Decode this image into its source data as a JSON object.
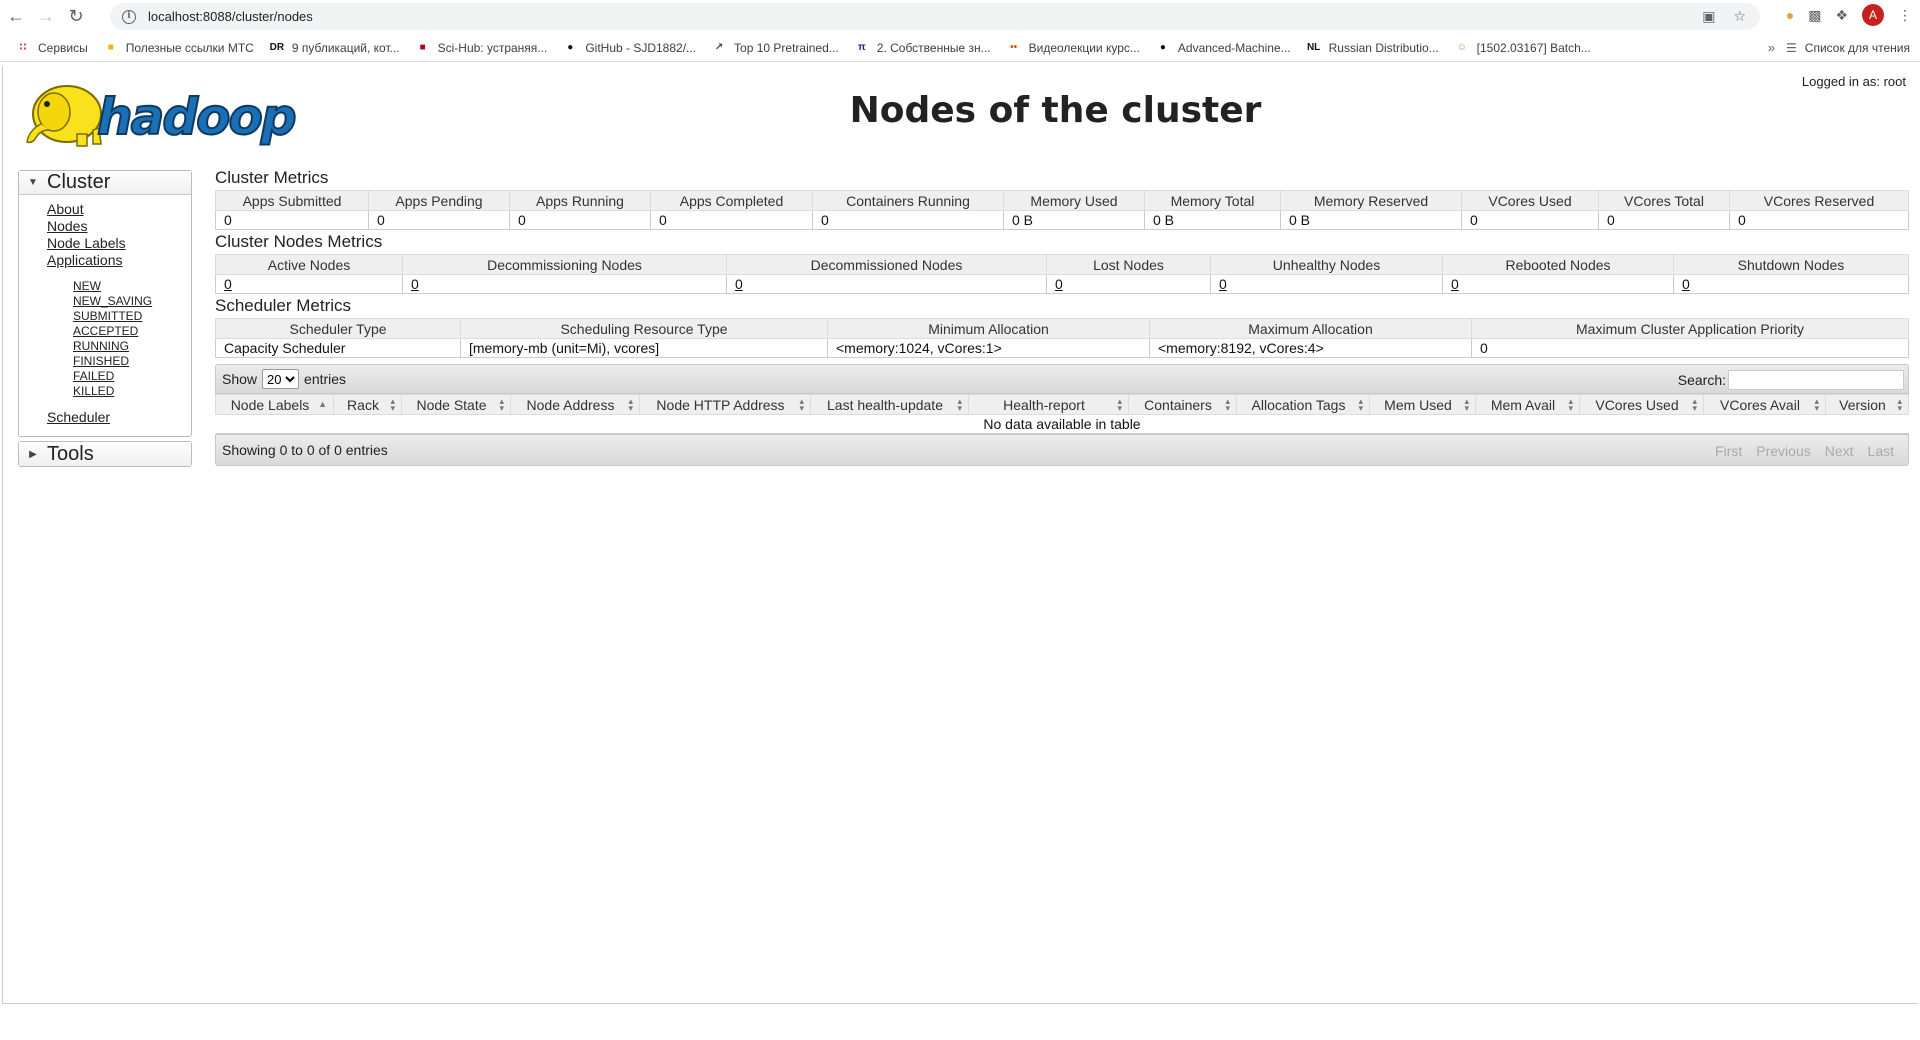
{
  "browser": {
    "url": "localhost:8088/cluster/nodes",
    "bookmarks": [
      {
        "label": "Сервисы",
        "icon": "apps-grid-icon",
        "color": "#d93025"
      },
      {
        "label": "Полезные ссылки МТС",
        "icon": "folder-icon",
        "color": "#f4b400"
      },
      {
        "label": "9 публикаций, кот...",
        "icon": "dr-icon",
        "color": "#111111"
      },
      {
        "label": "Sci-Hub: устраняя...",
        "icon": "scihub-icon",
        "color": "#b3001b"
      },
      {
        "label": "GitHub - SJD1882/...",
        "icon": "github-icon",
        "color": "#111111"
      },
      {
        "label": "Top 10 Pretrained...",
        "icon": "chart-line-icon",
        "color": "#444444"
      },
      {
        "label": "2. Собственные зн...",
        "icon": "pi-icon",
        "color": "#1a237e"
      },
      {
        "label": "Видеолекции курс...",
        "icon": "dots-icon",
        "color": "#e65100"
      },
      {
        "label": "Advanced-Machine...",
        "icon": "github-icon",
        "color": "#111111"
      },
      {
        "label": "Russian Distributio...",
        "icon": "nl-icon",
        "color": "#111111"
      },
      {
        "label": "[1502.03167] Batch...",
        "icon": "smiley-icon",
        "color": "#7cb342"
      }
    ],
    "reading_list": "Список для чтения",
    "avatar_letter": "A"
  },
  "header": {
    "title": "Nodes of the cluster",
    "logged_in": "Logged in as: root"
  },
  "sidebar": {
    "cluster": {
      "label": "Cluster",
      "links": [
        "About",
        "Nodes",
        "Node Labels",
        "Applications"
      ],
      "app_states": [
        "NEW",
        "NEW_SAVING",
        "SUBMITTED",
        "ACCEPTED",
        "RUNNING",
        "FINISHED",
        "FAILED",
        "KILLED"
      ],
      "scheduler": "Scheduler"
    },
    "tools": {
      "label": "Tools"
    }
  },
  "cluster_metrics": {
    "title": "Cluster Metrics",
    "headers": [
      "Apps Submitted",
      "Apps Pending",
      "Apps Running",
      "Apps Completed",
      "Containers Running",
      "Memory Used",
      "Memory Total",
      "Memory Reserved",
      "VCores Used",
      "VCores Total",
      "VCores Reserved"
    ],
    "values": [
      "0",
      "0",
      "0",
      "0",
      "0",
      "0 B",
      "0 B",
      "0 B",
      "0",
      "0",
      "0"
    ]
  },
  "node_metrics": {
    "title": "Cluster Nodes Metrics",
    "headers": [
      "Active Nodes",
      "Decommissioning Nodes",
      "Decommissioned Nodes",
      "Lost Nodes",
      "Unhealthy Nodes",
      "Rebooted Nodes",
      "Shutdown Nodes"
    ],
    "values": [
      "0",
      "0",
      "0",
      "0",
      "0",
      "0",
      "0"
    ]
  },
  "scheduler_metrics": {
    "title": "Scheduler Metrics",
    "headers": [
      "Scheduler Type",
      "Scheduling Resource Type",
      "Minimum Allocation",
      "Maximum Allocation",
      "Maximum Cluster Application Priority"
    ],
    "values": [
      "Capacity Scheduler",
      "[memory-mb (unit=Mi), vcores]",
      "<memory:1024, vCores:1>",
      "<memory:8192, vCores:4>",
      "0"
    ]
  },
  "nodes_table": {
    "show_label": "Show",
    "entries_label": "entries",
    "page_size": "20",
    "page_size_options": [
      "20"
    ],
    "search_label": "Search:",
    "search_value": "",
    "headers": [
      "Node Labels",
      "Rack",
      "Node State",
      "Node Address",
      "Node HTTP Address",
      "Last health-update",
      "Health-report",
      "Containers",
      "Allocation Tags",
      "Mem Used",
      "Mem Avail",
      "VCores Used",
      "VCores Avail",
      "Version"
    ],
    "empty_text": "No data available in table",
    "info": "Showing 0 to 0 of 0 entries",
    "pager": [
      "First",
      "Previous",
      "Next",
      "Last"
    ]
  }
}
